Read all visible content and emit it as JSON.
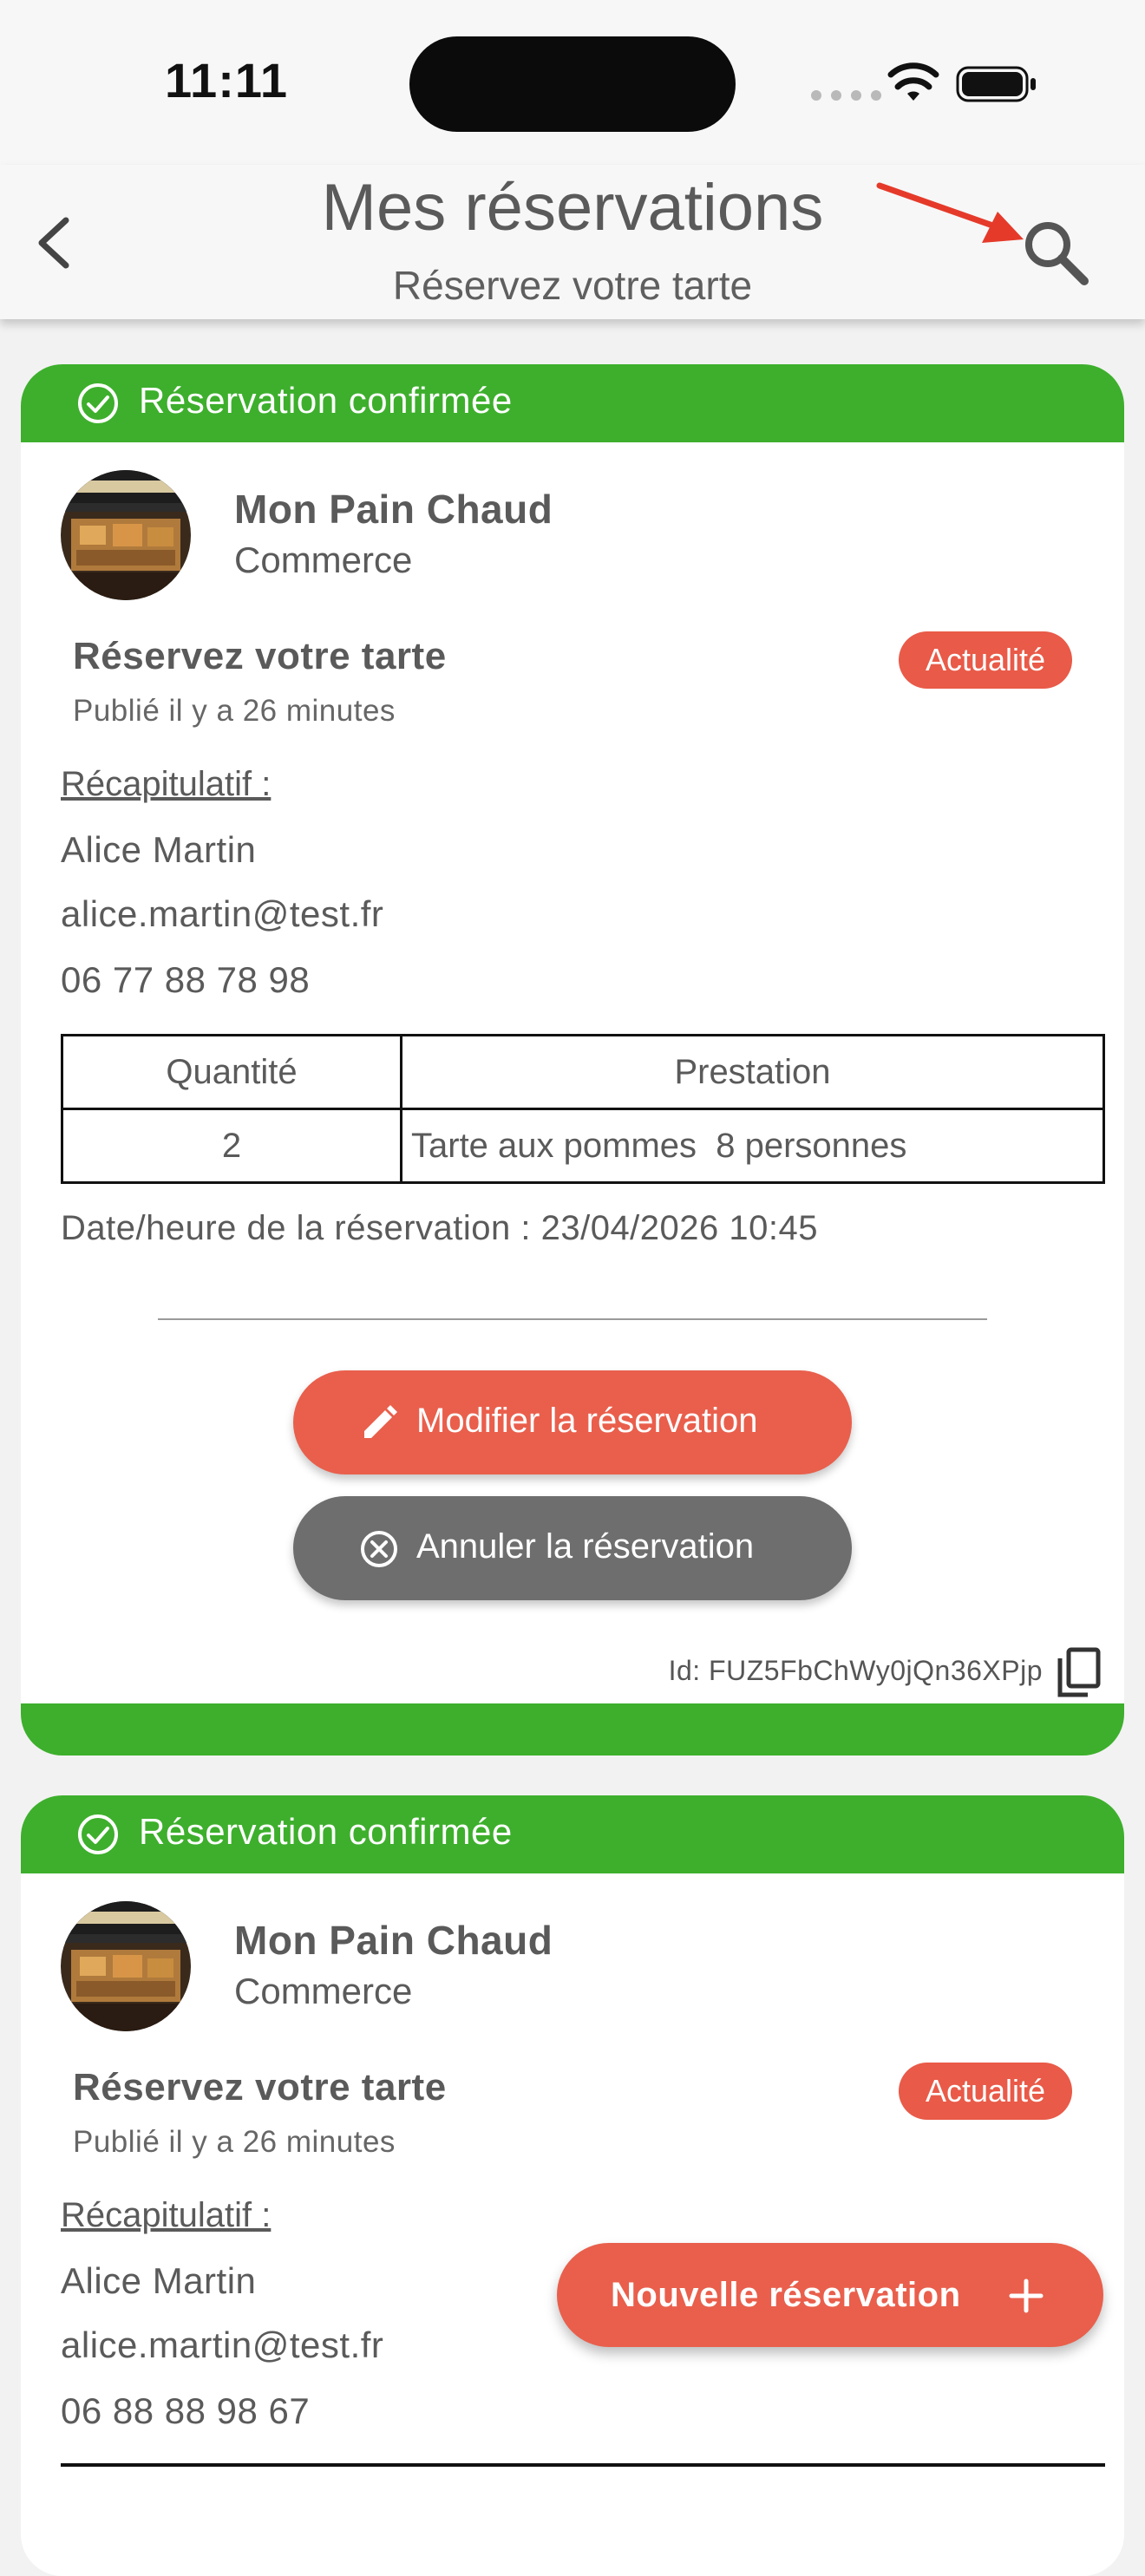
{
  "status_bar": {
    "time": "11:11"
  },
  "header": {
    "title": "Mes réservations",
    "subtitle": "Réservez votre tarte"
  },
  "colors": {
    "accent_green": "#3daf2c",
    "accent_red": "#e95f4c",
    "cancel_gray": "#6e6e6e",
    "annotation_arrow": "#e53a2a"
  },
  "icons": {
    "back": "chevron-left-icon",
    "search": "search-icon",
    "status": "check-circle-icon",
    "edit": "pencil-icon",
    "cancel": "x-circle-icon",
    "copy": "copy-icon",
    "add": "plus-icon"
  },
  "reservations": [
    {
      "status": "Réservation confirmée",
      "shop_name": "Mon Pain Chaud",
      "shop_type": "Commerce",
      "post_title": "Réservez votre tarte",
      "posted": "Publié il y a 26 minutes",
      "badge": "Actualité",
      "recap_label": "Récapitulatif :",
      "name": "Alice Martin",
      "email": "alice.martin@test.fr",
      "phone": "06 77 88 78 98",
      "table": {
        "headers": [
          "Quantité",
          "Prestation"
        ],
        "rows": [
          {
            "qty": "2",
            "prestation": "Tarte aux pommes  8 personnes"
          }
        ]
      },
      "date": "Date/heure de la réservation : 23/04/2026 10:45",
      "edit_label": "Modifier la réservation",
      "cancel_label": "Annuler la réservation",
      "id_text": "Id: FUZ5FbChWy0jQn36XPjp"
    },
    {
      "status": "Réservation confirmée",
      "shop_name": "Mon Pain Chaud",
      "shop_type": "Commerce",
      "post_title": "Réservez votre tarte",
      "posted": "Publié il y a 26 minutes",
      "badge": "Actualité",
      "recap_label": "Récapitulatif :",
      "name": "Alice Martin",
      "email": "alice.martin@test.fr",
      "phone": "06 88 88 98 67"
    }
  ],
  "fab": {
    "label": "Nouvelle réservation"
  }
}
